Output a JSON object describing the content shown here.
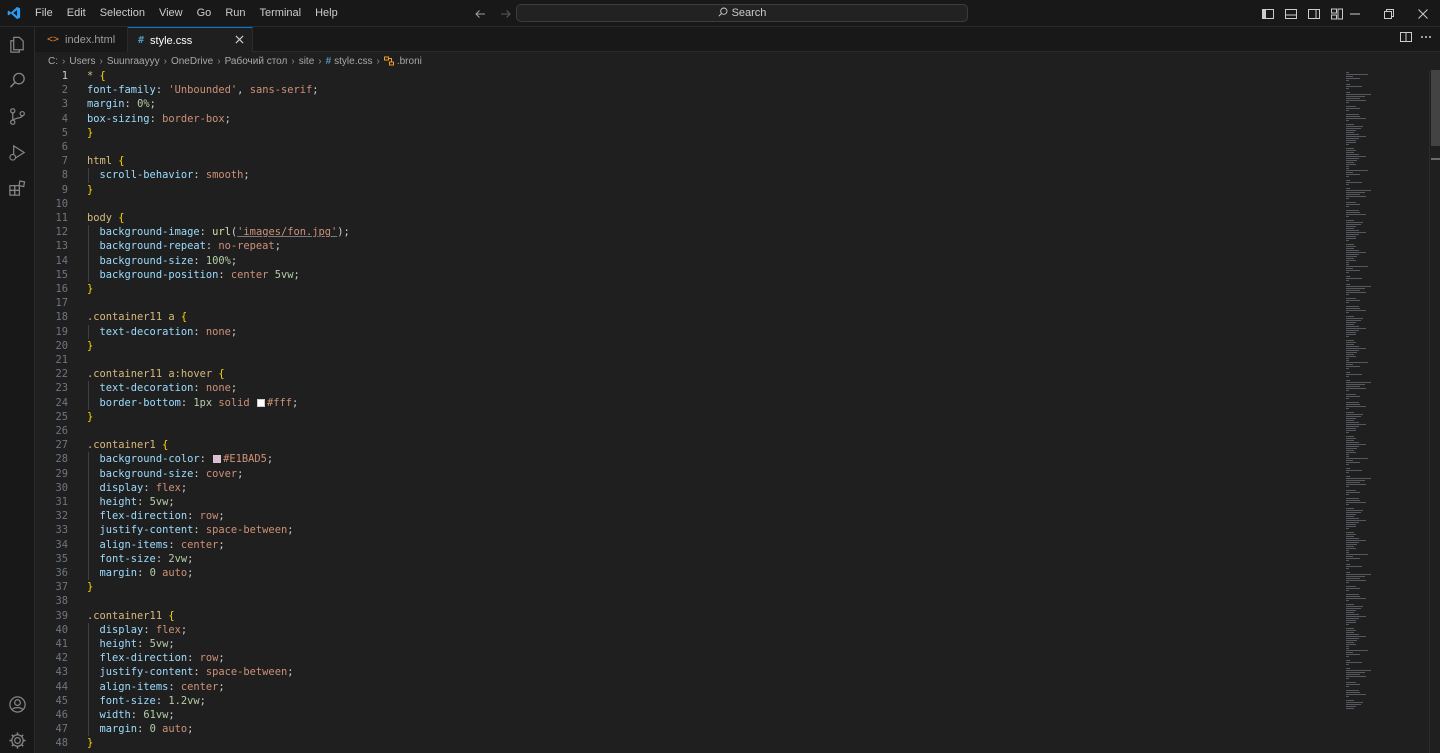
{
  "menu": [
    "File",
    "Edit",
    "Selection",
    "View",
    "Go",
    "Run",
    "Terminal",
    "Help"
  ],
  "search": {
    "label": "Search"
  },
  "tabs": [
    {
      "label": "index.html",
      "icon": "<>",
      "active": false
    },
    {
      "label": "style.css",
      "icon": "#",
      "active": true
    }
  ],
  "breadcrumb": [
    "C:",
    "Users",
    "Suunraayyy",
    "OneDrive",
    "Рабочий стол",
    "site",
    "style.css",
    ".broni"
  ],
  "colors": {
    "accent": "#0078d4",
    "selector": "#d7ba7d",
    "property": "#9cdcfe",
    "value": "#ce9178",
    "number": "#b5cea8",
    "brace": "#ffd700",
    "function": "#dcdcaa"
  },
  "editor": {
    "current_line": 1,
    "lines": [
      [
        [
          "sel",
          "* "
        ],
        [
          "brace",
          "{"
        ]
      ],
      [
        [
          "prop",
          "font-family"
        ],
        [
          "plain",
          ": "
        ],
        [
          "val",
          "'Unbounded'"
        ],
        [
          "plain",
          ", "
        ],
        [
          "val",
          "sans-serif"
        ],
        [
          "plain",
          ";"
        ]
      ],
      [
        [
          "prop",
          "margin"
        ],
        [
          "plain",
          ": "
        ],
        [
          "num",
          "0%"
        ],
        [
          "plain",
          ";"
        ]
      ],
      [
        [
          "prop",
          "box-sizing"
        ],
        [
          "plain",
          ": "
        ],
        [
          "val",
          "border-box"
        ],
        [
          "plain",
          ";"
        ]
      ],
      [
        [
          "brace",
          "}"
        ]
      ],
      [],
      [
        [
          "sel",
          "html "
        ],
        [
          "brace",
          "{"
        ]
      ],
      [
        [
          "plain",
          "  "
        ],
        [
          "prop",
          "scroll-behavior"
        ],
        [
          "plain",
          ": "
        ],
        [
          "val",
          "smooth"
        ],
        [
          "plain",
          ";"
        ]
      ],
      [
        [
          "brace",
          "}"
        ]
      ],
      [],
      [
        [
          "sel",
          "body "
        ],
        [
          "brace",
          "{"
        ]
      ],
      [
        [
          "plain",
          "  "
        ],
        [
          "prop",
          "background-image"
        ],
        [
          "plain",
          ": "
        ],
        [
          "fn",
          "url"
        ],
        [
          "plain",
          "("
        ],
        [
          "str",
          "'images/fon.jpg'"
        ],
        [
          "plain",
          ");"
        ]
      ],
      [
        [
          "plain",
          "  "
        ],
        [
          "prop",
          "background-repeat"
        ],
        [
          "plain",
          ": "
        ],
        [
          "val",
          "no-repeat"
        ],
        [
          "plain",
          ";"
        ]
      ],
      [
        [
          "plain",
          "  "
        ],
        [
          "prop",
          "background-size"
        ],
        [
          "plain",
          ": "
        ],
        [
          "num",
          "100%"
        ],
        [
          "plain",
          ";"
        ]
      ],
      [
        [
          "plain",
          "  "
        ],
        [
          "prop",
          "background-position"
        ],
        [
          "plain",
          ": "
        ],
        [
          "val",
          "center "
        ],
        [
          "num",
          "5vw"
        ],
        [
          "plain",
          ";"
        ]
      ],
      [
        [
          "brace",
          "}"
        ]
      ],
      [],
      [
        [
          "sel",
          ".container11 a "
        ],
        [
          "brace",
          "{"
        ]
      ],
      [
        [
          "plain",
          "  "
        ],
        [
          "prop",
          "text-decoration"
        ],
        [
          "plain",
          ": "
        ],
        [
          "val",
          "none"
        ],
        [
          "plain",
          ";"
        ]
      ],
      [
        [
          "brace",
          "}"
        ]
      ],
      [],
      [
        [
          "sel",
          ".container11 a:hover "
        ],
        [
          "brace",
          "{"
        ]
      ],
      [
        [
          "plain",
          "  "
        ],
        [
          "prop",
          "text-decoration"
        ],
        [
          "plain",
          ": "
        ],
        [
          "val",
          "none"
        ],
        [
          "plain",
          ";"
        ]
      ],
      [
        [
          "plain",
          "  "
        ],
        [
          "prop",
          "border-bottom"
        ],
        [
          "plain",
          ": "
        ],
        [
          "num",
          "1px"
        ],
        [
          "plain",
          " "
        ],
        [
          "val",
          "solid "
        ],
        [
          "swatch",
          "#ffffff"
        ],
        [
          "val",
          "#fff"
        ],
        [
          "plain",
          ";"
        ]
      ],
      [
        [
          "brace",
          "}"
        ]
      ],
      [],
      [
        [
          "sel",
          ".container1 "
        ],
        [
          "brace",
          "{"
        ]
      ],
      [
        [
          "plain",
          "  "
        ],
        [
          "prop",
          "background-color"
        ],
        [
          "plain",
          ": "
        ],
        [
          "swatch",
          "#E1BAD5"
        ],
        [
          "val",
          "#E1BAD5"
        ],
        [
          "plain",
          ";"
        ]
      ],
      [
        [
          "plain",
          "  "
        ],
        [
          "prop",
          "background-size"
        ],
        [
          "plain",
          ": "
        ],
        [
          "val",
          "cover"
        ],
        [
          "plain",
          ";"
        ]
      ],
      [
        [
          "plain",
          "  "
        ],
        [
          "prop",
          "display"
        ],
        [
          "plain",
          ": "
        ],
        [
          "val",
          "flex"
        ],
        [
          "plain",
          ";"
        ]
      ],
      [
        [
          "plain",
          "  "
        ],
        [
          "prop",
          "height"
        ],
        [
          "plain",
          ": "
        ],
        [
          "num",
          "5vw"
        ],
        [
          "plain",
          ";"
        ]
      ],
      [
        [
          "plain",
          "  "
        ],
        [
          "prop",
          "flex-direction"
        ],
        [
          "plain",
          ": "
        ],
        [
          "val",
          "row"
        ],
        [
          "plain",
          ";"
        ]
      ],
      [
        [
          "plain",
          "  "
        ],
        [
          "prop",
          "justify-content"
        ],
        [
          "plain",
          ": "
        ],
        [
          "val",
          "space-between"
        ],
        [
          "plain",
          ";"
        ]
      ],
      [
        [
          "plain",
          "  "
        ],
        [
          "prop",
          "align-items"
        ],
        [
          "plain",
          ": "
        ],
        [
          "val",
          "center"
        ],
        [
          "plain",
          ";"
        ]
      ],
      [
        [
          "plain",
          "  "
        ],
        [
          "prop",
          "font-size"
        ],
        [
          "plain",
          ": "
        ],
        [
          "num",
          "2vw"
        ],
        [
          "plain",
          ";"
        ]
      ],
      [
        [
          "plain",
          "  "
        ],
        [
          "prop",
          "margin"
        ],
        [
          "plain",
          ": "
        ],
        [
          "num",
          "0"
        ],
        [
          "plain",
          " "
        ],
        [
          "val",
          "auto"
        ],
        [
          "plain",
          ";"
        ]
      ],
      [
        [
          "brace",
          "}"
        ]
      ],
      [],
      [
        [
          "sel",
          ".container11 "
        ],
        [
          "brace",
          "{"
        ]
      ],
      [
        [
          "plain",
          "  "
        ],
        [
          "prop",
          "display"
        ],
        [
          "plain",
          ": "
        ],
        [
          "val",
          "flex"
        ],
        [
          "plain",
          ";"
        ]
      ],
      [
        [
          "plain",
          "  "
        ],
        [
          "prop",
          "height"
        ],
        [
          "plain",
          ": "
        ],
        [
          "num",
          "5vw"
        ],
        [
          "plain",
          ";"
        ]
      ],
      [
        [
          "plain",
          "  "
        ],
        [
          "prop",
          "flex-direction"
        ],
        [
          "plain",
          ": "
        ],
        [
          "val",
          "row"
        ],
        [
          "plain",
          ";"
        ]
      ],
      [
        [
          "plain",
          "  "
        ],
        [
          "prop",
          "justify-content"
        ],
        [
          "plain",
          ": "
        ],
        [
          "val",
          "space-between"
        ],
        [
          "plain",
          ";"
        ]
      ],
      [
        [
          "plain",
          "  "
        ],
        [
          "prop",
          "align-items"
        ],
        [
          "plain",
          ": "
        ],
        [
          "val",
          "center"
        ],
        [
          "plain",
          ";"
        ]
      ],
      [
        [
          "plain",
          "  "
        ],
        [
          "prop",
          "font-size"
        ],
        [
          "plain",
          ": "
        ],
        [
          "num",
          "1.2vw"
        ],
        [
          "plain",
          ";"
        ]
      ],
      [
        [
          "plain",
          "  "
        ],
        [
          "prop",
          "width"
        ],
        [
          "plain",
          ": "
        ],
        [
          "num",
          "61vw"
        ],
        [
          "plain",
          ";"
        ]
      ],
      [
        [
          "plain",
          "  "
        ],
        [
          "prop",
          "margin"
        ],
        [
          "plain",
          ": "
        ],
        [
          "num",
          "0"
        ],
        [
          "plain",
          " "
        ],
        [
          "val",
          "auto"
        ],
        [
          "plain",
          ";"
        ]
      ],
      [
        [
          "brace",
          "}"
        ]
      ]
    ]
  },
  "icons": {
    "app": "vscode-logo-icon",
    "activity": [
      "explorer-icon",
      "search-icon",
      "source-control-icon",
      "run-debug-icon",
      "extensions-icon"
    ],
    "activity_bottom": [
      "account-icon",
      "settings-gear-icon"
    ]
  }
}
